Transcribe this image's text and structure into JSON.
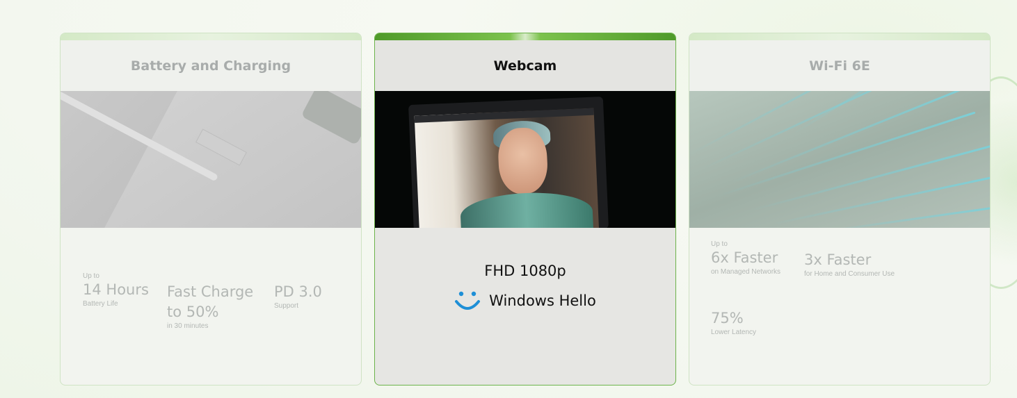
{
  "cards": [
    {
      "title": "Battery and Charging",
      "stats": [
        {
          "pre": "Up to",
          "value": "14 Hours",
          "sub": "Battery Life"
        },
        {
          "pre": "",
          "value": "Fast Charge to 50%",
          "sub": "in 30 minutes"
        },
        {
          "pre": "",
          "value": "PD 3.0",
          "sub": "Support"
        }
      ]
    },
    {
      "title": "Webcam",
      "features": [
        "FHD 1080p",
        "Windows Hello"
      ]
    },
    {
      "title": "Wi-Fi 6E",
      "stats": [
        {
          "pre": "Up to",
          "value": "6x Faster",
          "sub": "on Managed Networks"
        },
        {
          "pre": "",
          "value": "3x Faster",
          "sub": "for Home and Consumer Use"
        },
        {
          "pre": "",
          "value": "75%",
          "sub": "Lower Latency"
        }
      ]
    }
  ],
  "colors": {
    "accent": "#5aa632",
    "hello_icon": "#1e8fd6"
  },
  "icons": {
    "windows_hello": "windows-hello-smiley-icon"
  }
}
